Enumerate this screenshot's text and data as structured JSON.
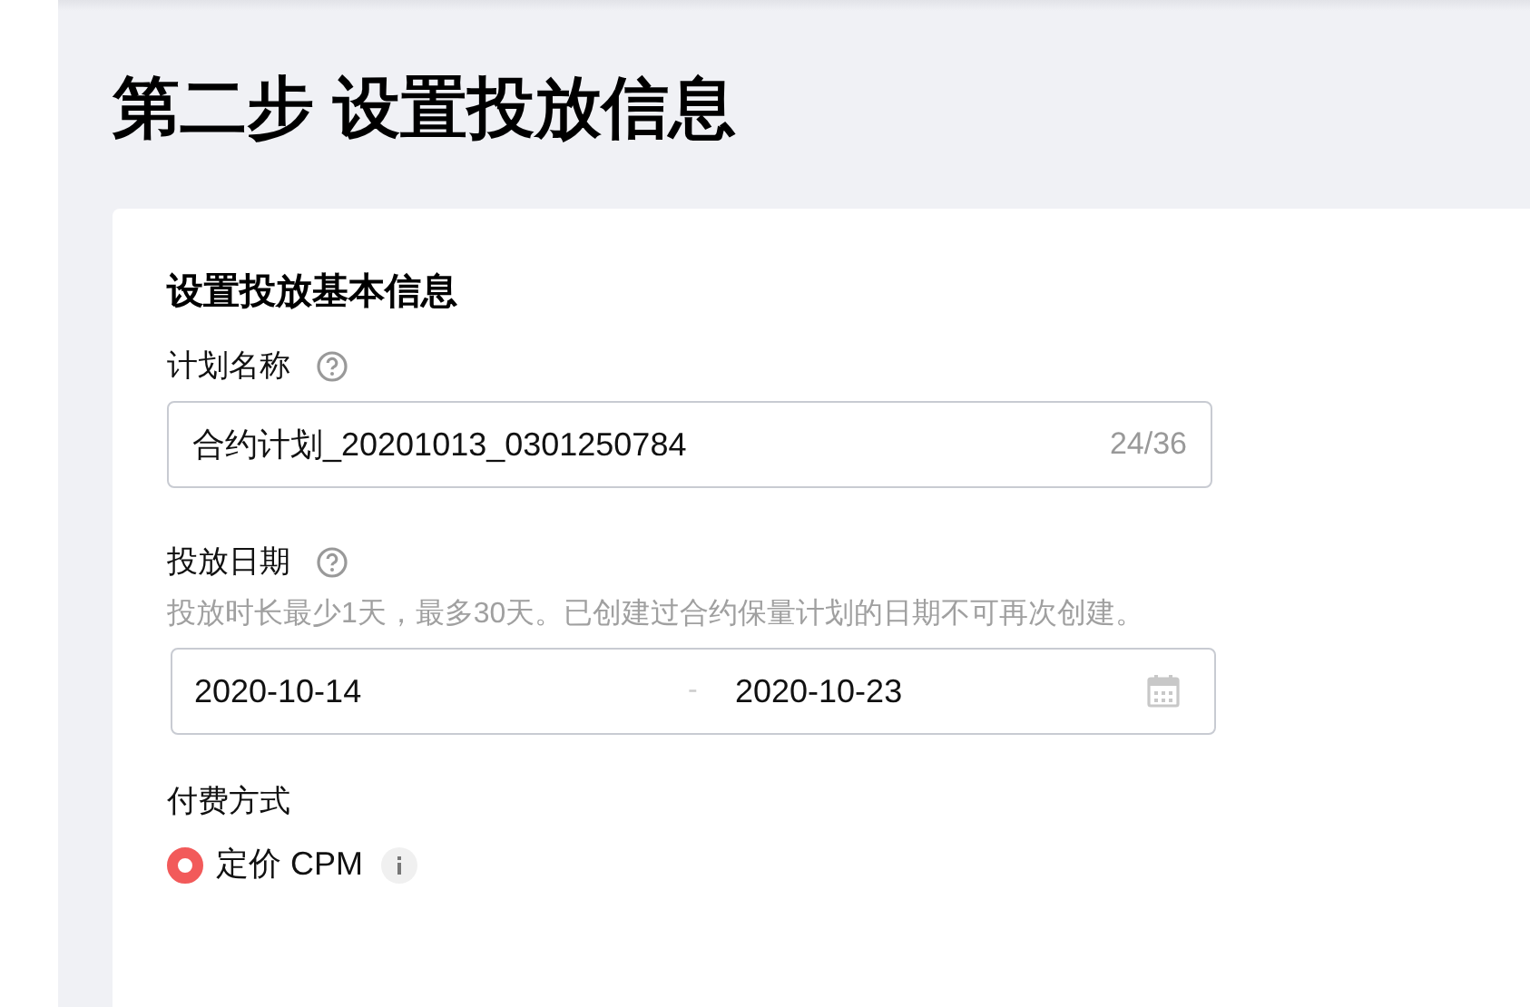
{
  "page_title": "第二步 设置投放信息",
  "section_title": "设置投放基本信息",
  "plan_name": {
    "label": "计划名称",
    "value": "合约计划_20201013_0301250784",
    "counter": "24/36"
  },
  "date": {
    "label": "投放日期",
    "hint": "投放时长最少1天，最多30天。已创建过合约保量计划的日期不可再次创建。",
    "start": "2020-10-14",
    "separator": "-",
    "end": "2020-10-23"
  },
  "payment": {
    "label": "付费方式",
    "options": [
      {
        "label": "定价 CPM",
        "selected": true
      }
    ]
  }
}
